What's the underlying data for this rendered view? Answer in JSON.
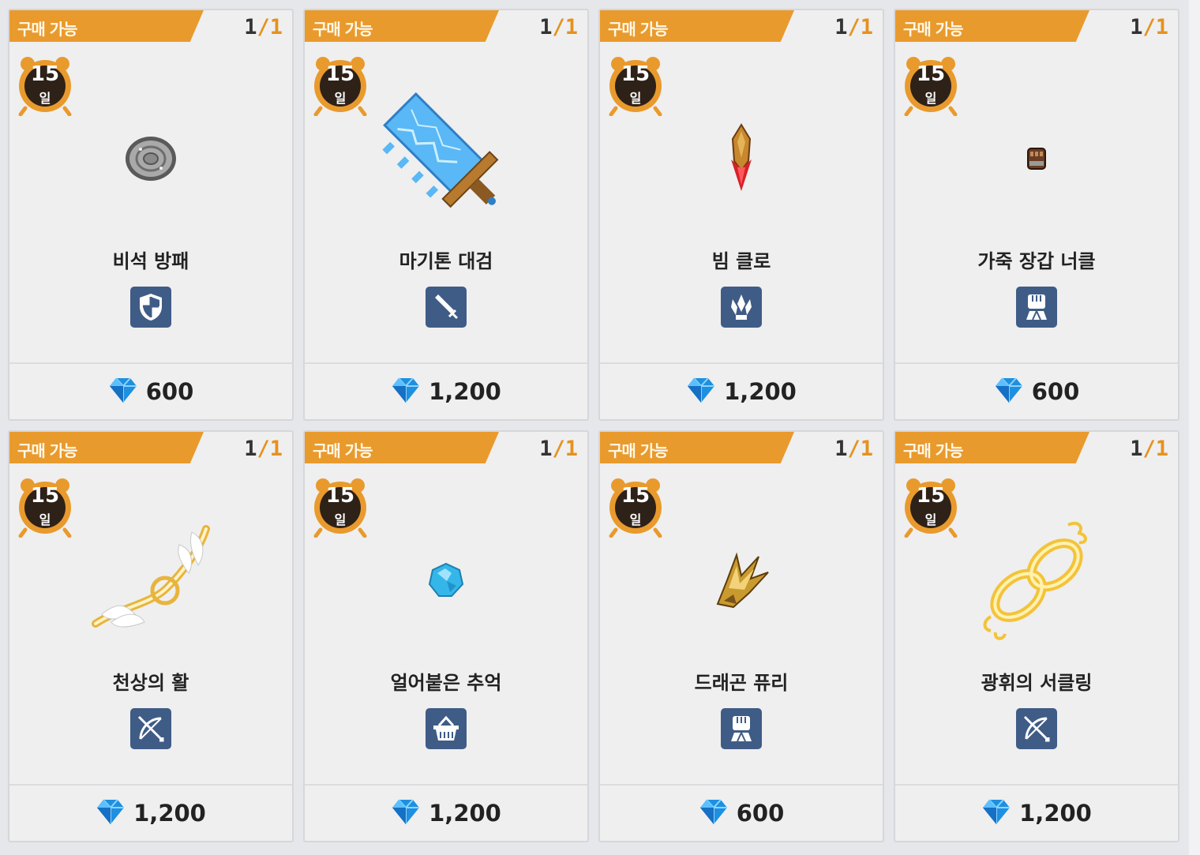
{
  "shop": {
    "items": [
      {
        "status": "구매 가능",
        "count": "1",
        "total": "1",
        "timer_value": "15",
        "timer_unit": "일",
        "name": "비석 방패",
        "class_icon": "shield-icon",
        "price": "600",
        "item_icon": "tombstone-shield"
      },
      {
        "status": "구매 가능",
        "count": "1",
        "total": "1",
        "timer_value": "15",
        "timer_unit": "일",
        "name": "마기톤 대검",
        "class_icon": "sword-icon",
        "price": "1,200",
        "item_icon": "magiton-greatsword"
      },
      {
        "status": "구매 가능",
        "count": "1",
        "total": "1",
        "timer_value": "15",
        "timer_unit": "일",
        "name": "빔 클로",
        "class_icon": "claw-icon",
        "price": "1,200",
        "item_icon": "beam-claw"
      },
      {
        "status": "구매 가능",
        "count": "1",
        "total": "1",
        "timer_value": "15",
        "timer_unit": "일",
        "name": "가죽 장갑 너클",
        "class_icon": "fist-icon",
        "price": "600",
        "item_icon": "leather-glove-knuckle"
      },
      {
        "status": "구매 가능",
        "count": "1",
        "total": "1",
        "timer_value": "15",
        "timer_unit": "일",
        "name": "천상의 활",
        "class_icon": "bow-icon",
        "price": "1,200",
        "item_icon": "celestial-bow"
      },
      {
        "status": "구매 가능",
        "count": "1",
        "total": "1",
        "timer_value": "15",
        "timer_unit": "일",
        "name": "얼어붙은 추억",
        "class_icon": "basket-icon",
        "price": "1,200",
        "item_icon": "frozen-memory-gem"
      },
      {
        "status": "구매 가능",
        "count": "1",
        "total": "1",
        "timer_value": "15",
        "timer_unit": "일",
        "name": "드래곤 퓨리",
        "class_icon": "fist-icon",
        "price": "600",
        "item_icon": "dragon-fury"
      },
      {
        "status": "구매 가능",
        "count": "1",
        "total": "1",
        "timer_value": "15",
        "timer_unit": "일",
        "name": "광휘의 서클링",
        "class_icon": "bow-icon",
        "price": "1,200",
        "item_icon": "radiant-circling"
      }
    ],
    "colors": {
      "tag_orange": "#e99a2d",
      "count_orange": "#e5921f",
      "class_icon_bg": "#3f5c86",
      "timer_dark": "#2e2118",
      "diamond_blue": "#1e90e0"
    }
  }
}
